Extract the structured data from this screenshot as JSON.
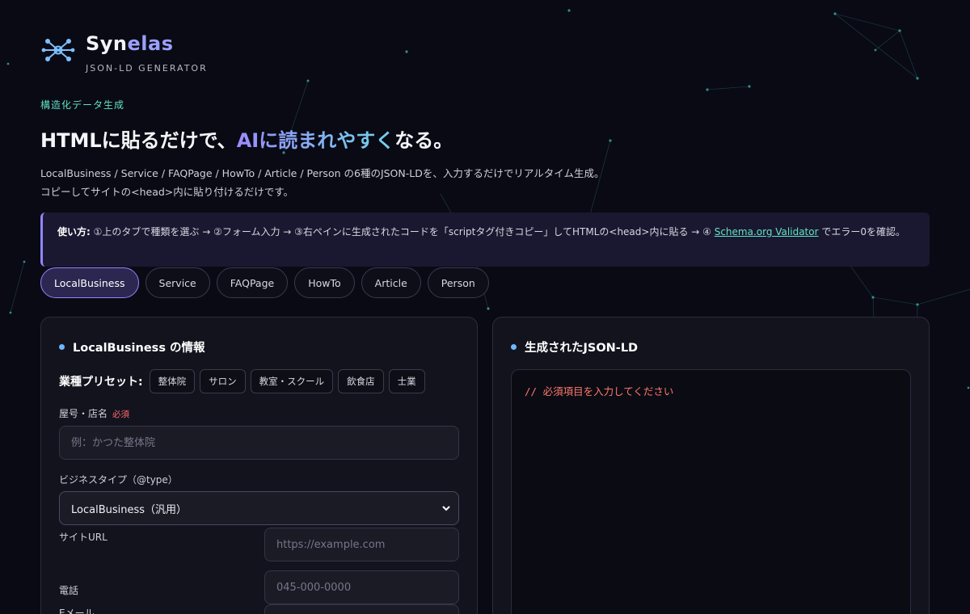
{
  "brand": {
    "name_part1": "Syn",
    "name_part2": "elas",
    "subtitle": "JSON-LD GENERATOR"
  },
  "hero": {
    "eyebrow": "構造化データ生成",
    "headline_pre": "HTMLに貼るだけで、",
    "headline_grad": "AIに読まれやすく",
    "headline_post": "なる。",
    "desc_line1": "LocalBusiness / Service / FAQPage / HowTo / Article / Person の6種のJSON-LDを、入力するだけでリアルタイム生成。",
    "desc_line2": "コピーしてサイトの<head>内に貼り付けるだけです。"
  },
  "howto": {
    "label": "使い方:",
    "text1": " ①上のタブで種類を選ぶ → ②フォーム入力 → ③右ペインに生成されたコードを「scriptタグ付きコピー」してHTMLの<head>内に貼る → ④ ",
    "link": "Schema.org Validator",
    "text2": " でエラー0を確認。"
  },
  "tabs": [
    "LocalBusiness",
    "Service",
    "FAQPage",
    "HowTo",
    "Article",
    "Person"
  ],
  "active_tab": "LocalBusiness",
  "form": {
    "title": "LocalBusiness の情報",
    "preset_label": "業種プリセット:",
    "presets": [
      "整体院",
      "サロン",
      "教室・スクール",
      "飲食店",
      "士業"
    ],
    "name_label": "屋号・店名",
    "required": "必須",
    "name_placeholder": "例：かつた整体院",
    "type_label": "ビジネスタイプ（@type）",
    "type_value": "LocalBusiness（汎用）",
    "url_label": "サイトURL",
    "url_placeholder": "https://example.com",
    "tel_label": "電話",
    "tel_placeholder": "045-000-0000",
    "email_label": "Eメール"
  },
  "output": {
    "title": "生成されたJSON-LD",
    "placeholder": "//  必須項目を入力してください"
  },
  "colors": {
    "accent": "#8f86ff",
    "teal": "#5fe3c4",
    "bg": "#0a0a14",
    "error": "#ff7a6b"
  }
}
